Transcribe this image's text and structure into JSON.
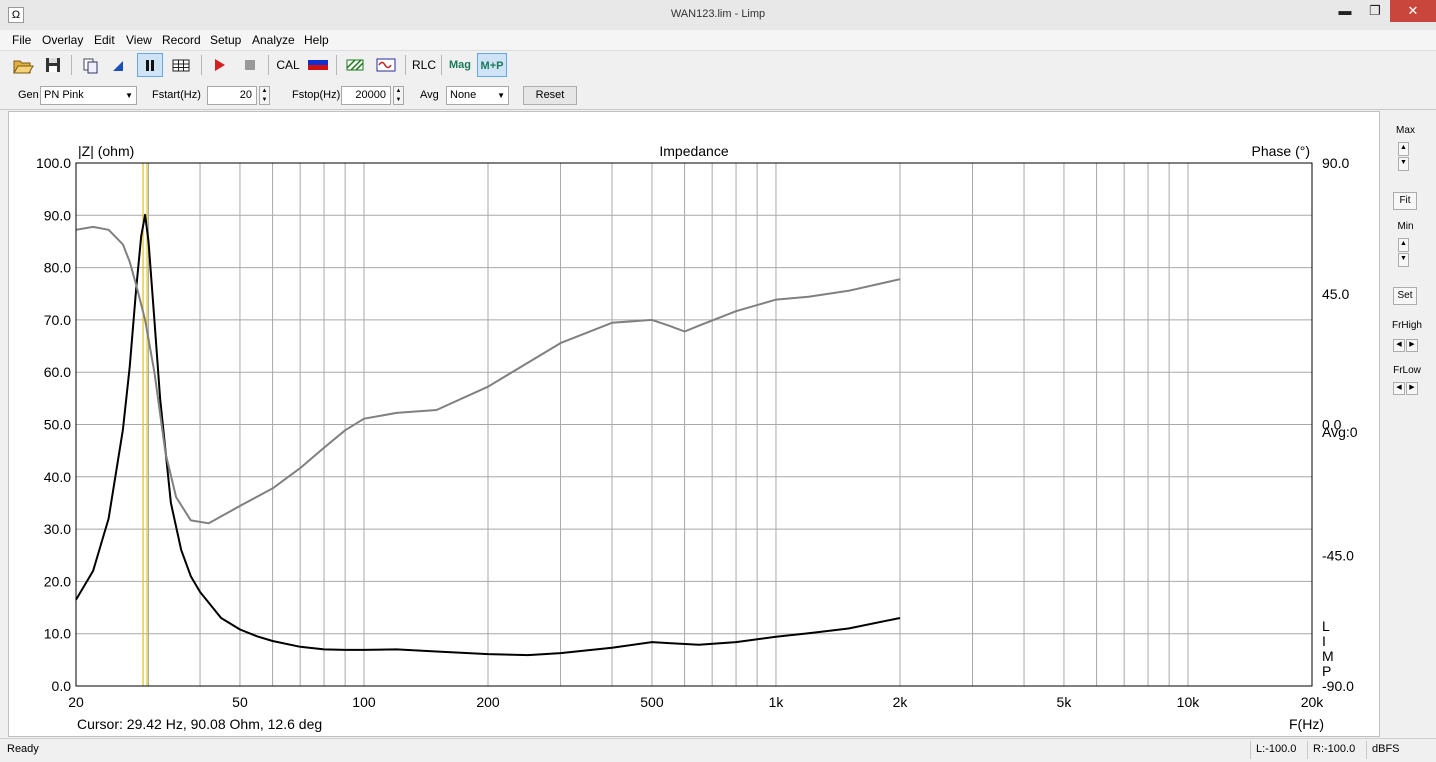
{
  "window": {
    "title": "WAN123.lim - Limp",
    "icon_glyph": "Ω",
    "minimize_glyph": "▬",
    "maximize_glyph": "❐",
    "close_glyph": "✕"
  },
  "menu": [
    "File",
    "Overlay",
    "Edit",
    "View",
    "Record",
    "Setup",
    "Analyze",
    "Help"
  ],
  "toolbar": {
    "cal_label": "CAL",
    "rlc_label": "RLC",
    "mag_label": "Mag",
    "mp_label": "M+P"
  },
  "gen_bar": {
    "gen_label": "Gen",
    "gen_value": "PN Pink",
    "fstart_label": "Fstart(Hz)",
    "fstart_value": "20",
    "fstop_label": "Fstop(Hz)",
    "fstop_value": "20000",
    "avg_label": "Avg",
    "avg_value": "None",
    "reset_label": "Reset"
  },
  "graph": {
    "left_axis_title": "|Z| (ohm)",
    "center_title": "Impedance",
    "right_axis_title": "Phase (°)",
    "avg_text": "Avg:0",
    "cursor_text": "Cursor: 29.42 Hz, 90.08 Ohm, 12.6 deg",
    "x_axis_title": "F(Hz)",
    "watermark": [
      "L",
      "I",
      "M",
      "P"
    ]
  },
  "chart_data": {
    "type": "line",
    "xscale": "log",
    "xlim": [
      20,
      20000
    ],
    "ylim": [
      0,
      100
    ],
    "y2lim": [
      -90,
      90
    ],
    "grid": true,
    "x_ticks": [
      {
        "v": 20,
        "label": "20"
      },
      {
        "v": 50,
        "label": "50"
      },
      {
        "v": 100,
        "label": "100"
      },
      {
        "v": 200,
        "label": "200"
      },
      {
        "v": 500,
        "label": "500"
      },
      {
        "v": 1000,
        "label": "1k"
      },
      {
        "v": 2000,
        "label": "2k"
      },
      {
        "v": 5000,
        "label": "5k"
      },
      {
        "v": 10000,
        "label": "10k"
      },
      {
        "v": 20000,
        "label": "20k"
      }
    ],
    "y_ticks": [
      "0.0",
      "10.0",
      "20.0",
      "30.0",
      "40.0",
      "50.0",
      "60.0",
      "70.0",
      "80.0",
      "90.0",
      "100.0"
    ],
    "y2_ticks": [
      {
        "v": 90,
        "label": "90.0"
      },
      {
        "v": 45,
        "label": "45.0"
      },
      {
        "v": 0,
        "label": "0.0"
      },
      {
        "v": -45,
        "label": "-45.0"
      },
      {
        "v": -90,
        "label": "-90.0"
      }
    ],
    "cursor_x": 29.42,
    "series": [
      {
        "axis": "left",
        "color": "#000000",
        "x": [
          20,
          22,
          24,
          26,
          27,
          28,
          28.8,
          29.42,
          30,
          31,
          32,
          34,
          36,
          38,
          40,
          45,
          50,
          55,
          60,
          70,
          80,
          90,
          100,
          120,
          150,
          200,
          250,
          300,
          400,
          500,
          550,
          650,
          800,
          1000,
          1200,
          1500,
          2000
        ],
        "y": [
          16.5,
          22,
          32,
          49,
          61,
          76,
          86,
          90.1,
          85,
          70,
          55,
          35,
          26,
          21,
          18,
          13,
          10.8,
          9.5,
          8.6,
          7.5,
          7.0,
          6.9,
          6.9,
          7.0,
          6.6,
          6.1,
          5.9,
          6.3,
          7.3,
          8.4,
          8.2,
          7.9,
          8.4,
          9.4,
          10.1,
          11.0,
          13.0
        ]
      },
      {
        "axis": "right",
        "color": "#808080",
        "x": [
          20,
          22,
          24,
          26,
          27,
          28,
          29.42,
          31,
          33,
          35,
          38,
          42,
          50,
          60,
          70,
          80,
          90,
          100,
          120,
          150,
          200,
          300,
          400,
          500,
          550,
          600,
          650,
          800,
          1000,
          1200,
          1500,
          2000
        ],
        "y": [
          67,
          68,
          67,
          62,
          56,
          48,
          36,
          18,
          -10,
          -25,
          -33,
          -34,
          -28,
          -22,
          -15,
          -8,
          -2,
          2,
          4,
          5,
          13,
          28,
          35,
          36,
          34,
          32,
          34,
          39,
          43,
          44,
          46,
          50
        ]
      }
    ]
  },
  "side_panel": {
    "max_label": "Max",
    "fit_label": "Fit",
    "min_label": "Min",
    "set_label": "Set",
    "frhigh_label": "FrHigh",
    "frlow_label": "FrLow"
  },
  "status": {
    "ready": "Ready",
    "left_level": "L:-100.0",
    "right_level": "R:-100.0",
    "unit": "dBFS"
  }
}
